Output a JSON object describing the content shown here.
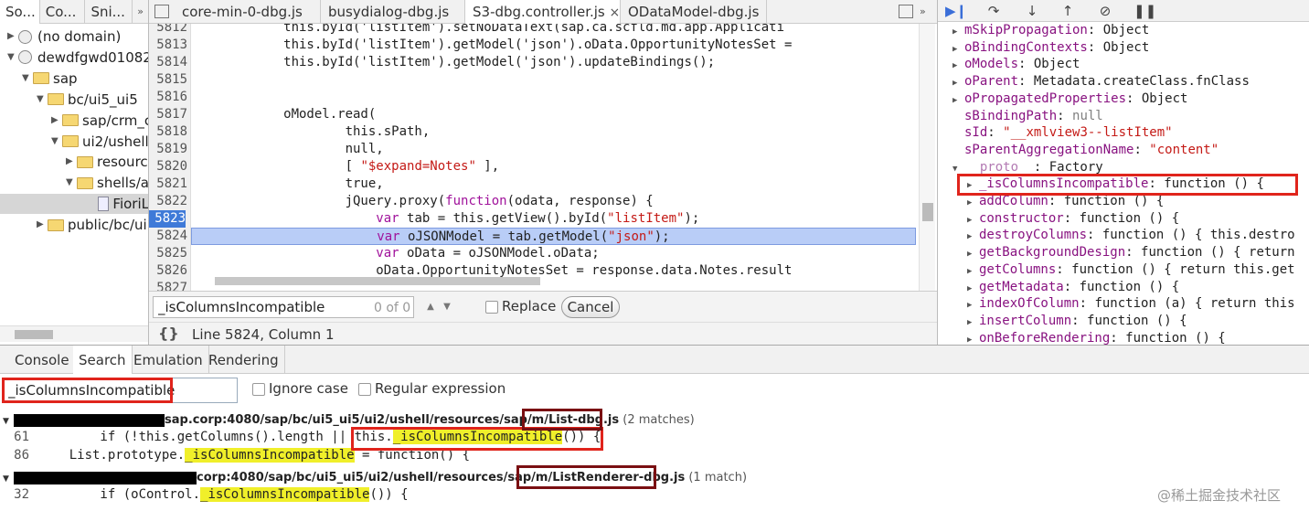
{
  "navigator": {
    "tabs": [
      "So...",
      "Co...",
      "Sni..."
    ],
    "more": "»",
    "tree": [
      {
        "label": "(no domain)",
        "kind": "globe",
        "open": false,
        "depth": 0
      },
      {
        "label": "dewdfgwd01082",
        "kind": "globe",
        "open": true,
        "depth": 0
      },
      {
        "label": "sap",
        "kind": "folder",
        "open": true,
        "depth": 1
      },
      {
        "label": "bc/ui5_ui5",
        "kind": "folder",
        "open": true,
        "depth": 2
      },
      {
        "label": "sap/crm_c",
        "kind": "folder",
        "open": false,
        "depth": 3
      },
      {
        "label": "ui2/ushell",
        "kind": "folder",
        "open": true,
        "depth": 3
      },
      {
        "label": "resourc",
        "kind": "folder",
        "open": false,
        "depth": 4
      },
      {
        "label": "shells/a",
        "kind": "folder",
        "open": true,
        "depth": 4
      },
      {
        "label": "FioriL",
        "kind": "file",
        "open": null,
        "depth": 5
      },
      {
        "label": "public/bc/ui",
        "kind": "folder",
        "open": false,
        "depth": 2
      }
    ]
  },
  "editor": {
    "tabs": [
      "core-min-0-dbg.js",
      "busydialog-dbg.js",
      "S3-dbg.controller.js",
      "ODataModel-dbg.js"
    ],
    "active_tab": "S3-dbg.controller.js",
    "close_glyph": "×",
    "more": "»",
    "breakpoint_line": "5823",
    "current_line": "5824",
    "lines": [
      {
        "n": "5812",
        "segs": [
          [
            "",
            "            this.byId('listItem').setNoDataText(sap.ca.scfld.md.app.Applicati"
          ]
        ]
      },
      {
        "n": "5813",
        "segs": [
          [
            "",
            "            this.byId('listItem').getModel('json').oData.OpportunityNotesSet ="
          ]
        ]
      },
      {
        "n": "5814",
        "segs": [
          [
            "",
            "            this.byId('listItem').getModel('json').updateBindings();"
          ]
        ]
      },
      {
        "n": "5815",
        "segs": [
          [
            "",
            ""
          ]
        ]
      },
      {
        "n": "5816",
        "segs": [
          [
            "",
            ""
          ]
        ]
      },
      {
        "n": "5817",
        "segs": [
          [
            "",
            "            oModel.read("
          ]
        ]
      },
      {
        "n": "5818",
        "segs": [
          [
            "",
            "                    this.sPath,"
          ]
        ]
      },
      {
        "n": "5819",
        "segs": [
          [
            "",
            "                    null,"
          ]
        ]
      },
      {
        "n": "5820",
        "segs": [
          [
            "",
            "                    [ "
          ],
          [
            "str",
            "\"$expand=Notes\""
          ],
          [
            "",
            " ],"
          ]
        ]
      },
      {
        "n": "5821",
        "segs": [
          [
            "",
            "                    true,"
          ]
        ]
      },
      {
        "n": "5822",
        "segs": [
          [
            "",
            "                    jQuery.proxy("
          ],
          [
            "kw",
            "function"
          ],
          [
            "",
            "(odata, response) {"
          ]
        ]
      },
      {
        "n": "5823",
        "segs": [
          [
            "",
            "                        "
          ],
          [
            "kw",
            "var"
          ],
          [
            "",
            " tab = this.getView().byId("
          ],
          [
            "str",
            "\"listItem\""
          ],
          [
            "",
            ");"
          ]
        ]
      },
      {
        "n": "5824",
        "segs": [
          [
            "",
            "                        "
          ],
          [
            "kw",
            "var"
          ],
          [
            "",
            " oJSONModel = tab.getModel("
          ],
          [
            "str",
            "\"json\""
          ],
          [
            "",
            ");"
          ]
        ]
      },
      {
        "n": "5825",
        "segs": [
          [
            "",
            "                        "
          ],
          [
            "kw",
            "var"
          ],
          [
            "",
            " oData = oJSONModel.oData;"
          ]
        ]
      },
      {
        "n": "5826",
        "segs": [
          [
            "",
            "                        oData.OpportunityNotesSet = response.data.Notes.result"
          ]
        ]
      },
      {
        "n": "5827",
        "segs": [
          [
            "",
            ""
          ]
        ]
      }
    ],
    "find": {
      "query": "_isColumnsIncompatible",
      "match_count": "0 of 0",
      "replace_label": "Replace",
      "cancel_label": "Cancel"
    },
    "status": {
      "pretty_print": "{}",
      "cursor": "Line 5824, Column 1"
    }
  },
  "sidebar": {
    "toolbar_icons": [
      "resume-icon",
      "step-over-icon",
      "step-into-icon",
      "step-out-icon",
      "deactivate-breakpoints-icon",
      "pause-on-exceptions-icon"
    ],
    "properties": [
      {
        "tri": "closed",
        "name": "mSkipPropagation",
        "value": "Object",
        "depth": 0,
        "vtype": "obj"
      },
      {
        "tri": "closed",
        "name": "oBindingContexts",
        "value": "Object",
        "depth": 0,
        "vtype": "obj"
      },
      {
        "tri": "closed",
        "name": "oModels",
        "value": "Object",
        "depth": 0,
        "vtype": "obj"
      },
      {
        "tri": "closed",
        "name": "oParent",
        "value": "Metadata.createClass.fnClass",
        "depth": 0,
        "vtype": "obj"
      },
      {
        "tri": "closed",
        "name": "oPropagatedProperties",
        "value": "Object",
        "depth": 0,
        "vtype": "obj"
      },
      {
        "tri": "none",
        "name": "sBindingPath",
        "value": "null",
        "depth": 0,
        "vtype": "nul"
      },
      {
        "tri": "none",
        "name": "sId",
        "value": "\"__xmlview3--listItem\"",
        "depth": 0,
        "vtype": "str"
      },
      {
        "tri": "none",
        "name": "sParentAggregationName",
        "value": "\"content\"",
        "depth": 0,
        "vtype": "str"
      },
      {
        "tri": "open",
        "name": "__proto__",
        "value": "Factory",
        "depth": 0,
        "vtype": "obj",
        "dim": true
      },
      {
        "tri": "closed",
        "name": "_isColumnsIncompatible",
        "value": "function () {",
        "depth": 1,
        "vtype": "obj"
      },
      {
        "tri": "closed",
        "name": "addColumn",
        "value": "function () {",
        "depth": 1,
        "vtype": "obj"
      },
      {
        "tri": "closed",
        "name": "constructor",
        "value": "function () {",
        "depth": 1,
        "vtype": "obj"
      },
      {
        "tri": "closed",
        "name": "destroyColumns",
        "value": "function () { this.destro",
        "depth": 1,
        "vtype": "obj"
      },
      {
        "tri": "closed",
        "name": "getBackgroundDesign",
        "value": "function () { return",
        "depth": 1,
        "vtype": "obj"
      },
      {
        "tri": "closed",
        "name": "getColumns",
        "value": "function () { return this.get",
        "depth": 1,
        "vtype": "obj"
      },
      {
        "tri": "closed",
        "name": "getMetadata",
        "value": "function () {",
        "depth": 1,
        "vtype": "obj"
      },
      {
        "tri": "closed",
        "name": "indexOfColumn",
        "value": "function (a) { return this",
        "depth": 1,
        "vtype": "obj"
      },
      {
        "tri": "closed",
        "name": "insertColumn",
        "value": "function () {",
        "depth": 1,
        "vtype": "obj"
      },
      {
        "tri": "closed",
        "name": "onBeforeRendering",
        "value": "function () {",
        "depth": 1,
        "vtype": "obj"
      }
    ]
  },
  "drawer": {
    "tabs": [
      "Console",
      "Search",
      "Emulation",
      "Rendering"
    ],
    "active_tab": "Search",
    "search": {
      "query": "_isColumnsIncompatible",
      "ignore_case": "Ignore case",
      "regex": "Regular expression"
    },
    "results": [
      {
        "url": "sap.corp:4080/sap/bc/ui5_ui5/ui2/ushell/resources/sap/m",
        "sep": "/",
        "file": "List-dbg.js",
        "count": "(2 matches)",
        "lines": [
          {
            "n": "61",
            "pre": "        if (!this.getColumns().length || this.",
            "mark": "_isColumnsIncompatible",
            "post": "()) {"
          },
          {
            "n": "86",
            "pre": "    List.prototype.",
            "mark": "_isColumnsIncompatible",
            "post": " = function() {"
          }
        ]
      },
      {
        "url": "corp:4080/sap/bc/ui5_ui5/ui2/ushell/resources/sap/m",
        "sep": "/",
        "file": "ListRenderer-dbg.js",
        "count": "(1 match)",
        "lines": [
          {
            "n": "32",
            "pre": "        if (oControl.",
            "mark": "_isColumnsIncompatible",
            "post": "()) {"
          }
        ]
      }
    ]
  },
  "watermark": "@稀土掘金技术社区"
}
